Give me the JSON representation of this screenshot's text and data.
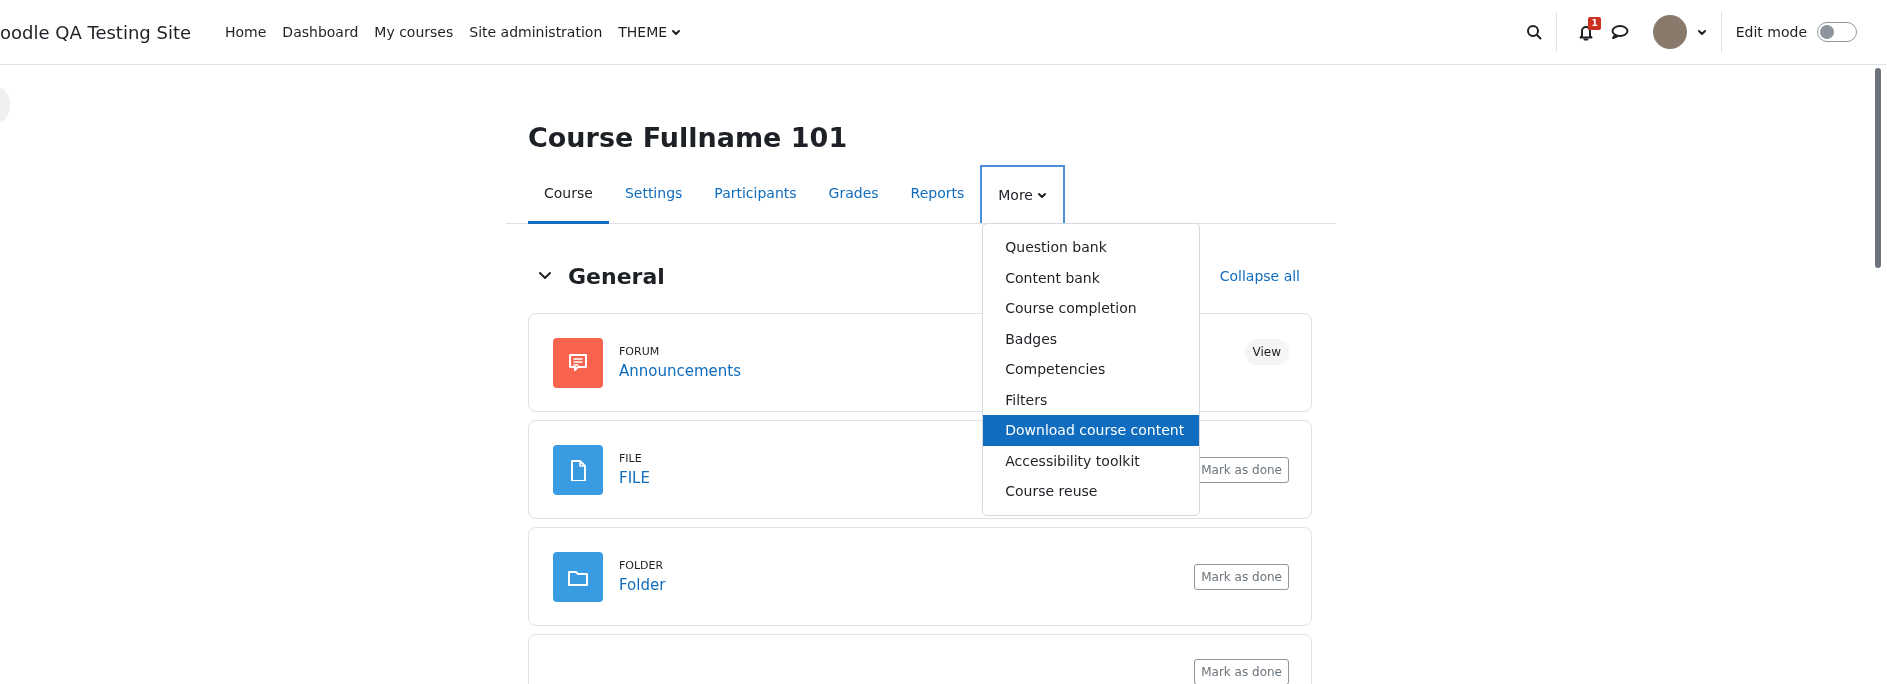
{
  "navbar": {
    "brand": "oodle QA Testing Site",
    "links": [
      {
        "label": "Home",
        "dropdown": false
      },
      {
        "label": "Dashboard",
        "dropdown": false
      },
      {
        "label": "My courses",
        "dropdown": false
      },
      {
        "label": "Site administration",
        "dropdown": false
      },
      {
        "label": "THEME",
        "dropdown": true
      }
    ],
    "notification_count": "1",
    "edit_mode": {
      "label": "Edit mode",
      "on": false
    }
  },
  "course": {
    "title": "Course Fullname 101",
    "tabs": [
      {
        "label": "Course",
        "selected": true
      },
      {
        "label": "Settings",
        "selected": false
      },
      {
        "label": "Participants",
        "selected": false
      },
      {
        "label": "Grades",
        "selected": false
      },
      {
        "label": "Reports",
        "selected": false
      }
    ],
    "more_tab": {
      "label": "More",
      "expanded": true,
      "items": [
        {
          "label": "Question bank",
          "selected": false
        },
        {
          "label": "Content bank",
          "selected": false
        },
        {
          "label": "Course completion",
          "selected": false
        },
        {
          "label": "Badges",
          "selected": false
        },
        {
          "label": "Competencies",
          "selected": false
        },
        {
          "label": "Filters",
          "selected": false
        },
        {
          "label": "Download course content",
          "selected": true
        },
        {
          "label": "Accessibility toolkit",
          "selected": false
        },
        {
          "label": "Course reuse",
          "selected": false
        }
      ]
    }
  },
  "section": {
    "title": "General",
    "expanded": true,
    "collapse_label": "Collapse all",
    "activities": [
      {
        "kind": "forum",
        "type_label": "FORUM",
        "name": "Announcements",
        "action": "View"
      },
      {
        "kind": "file",
        "type_label": "FILE",
        "name": "FILE",
        "action": "Mark as done"
      },
      {
        "kind": "folder",
        "type_label": "FOLDER",
        "name": "Folder",
        "action": "Mark as done"
      },
      {
        "kind": "hidden",
        "action": "Mark as done"
      }
    ]
  }
}
